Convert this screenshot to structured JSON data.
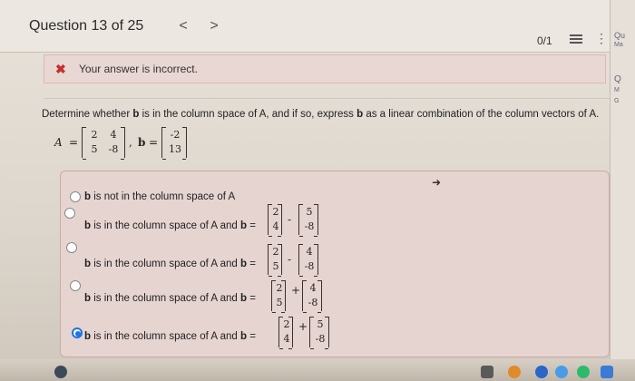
{
  "header": {
    "question_label": "Question 13 of 25",
    "prev": "<",
    "next": ">",
    "score": "0/1",
    "more": "⋮"
  },
  "side": {
    "l1": "Qu",
    "l2": "Ma",
    "l3": "Q",
    "l4": "M",
    "l5": "G"
  },
  "alert": {
    "icon": "✖",
    "text": "Your answer is incorrect."
  },
  "question": {
    "text_a": "Determine whether ",
    "bold_b1": "b",
    "text_b": " is in the column space of A, and if so, express ",
    "bold_b2": "b",
    "text_c": " as a linear combination of the column vectors of A.",
    "A_label": "A",
    "b_label": "b",
    "eq": "=",
    "comma": ",",
    "A": [
      [
        "2",
        "4"
      ],
      [
        "5",
        "-8"
      ]
    ],
    "b": [
      "-2",
      "13"
    ]
  },
  "options": [
    {
      "text_bold": "b",
      "text": " is not in the column space of A",
      "selected": false
    },
    {
      "text_bold": "b",
      "text": " is in the column space of A and ",
      "rhs_b": "b",
      "eq": "=",
      "v1": [
        "2",
        "4"
      ],
      "op": "-",
      "v2": [
        "5",
        "-8"
      ],
      "selected": false
    },
    {
      "text_bold": "b",
      "text": " is in the column space of A and ",
      "rhs_b": "b",
      "eq": "=",
      "v1": [
        "2",
        "5"
      ],
      "op": "-",
      "v2": [
        "4",
        "-8"
      ],
      "selected": false
    },
    {
      "text_bold": "b",
      "text": " is in the column space of A and ",
      "rhs_b": "b",
      "eq": "=",
      "v1": [
        "2",
        "5"
      ],
      "op": "+",
      "v2": [
        "4",
        "-8"
      ],
      "selected": false
    },
    {
      "text_bold": "b",
      "text": " is in the column space of A and ",
      "rhs_b": "b",
      "eq": "=",
      "v1": [
        "2",
        "4"
      ],
      "op": "+",
      "v2": [
        "5",
        "-8"
      ],
      "selected": true
    }
  ],
  "colors": {
    "accent": "#1a73e8",
    "error": "#c3302d",
    "alert_bg": "#e9d7d4",
    "answers_bg": "#e6d4d1"
  }
}
